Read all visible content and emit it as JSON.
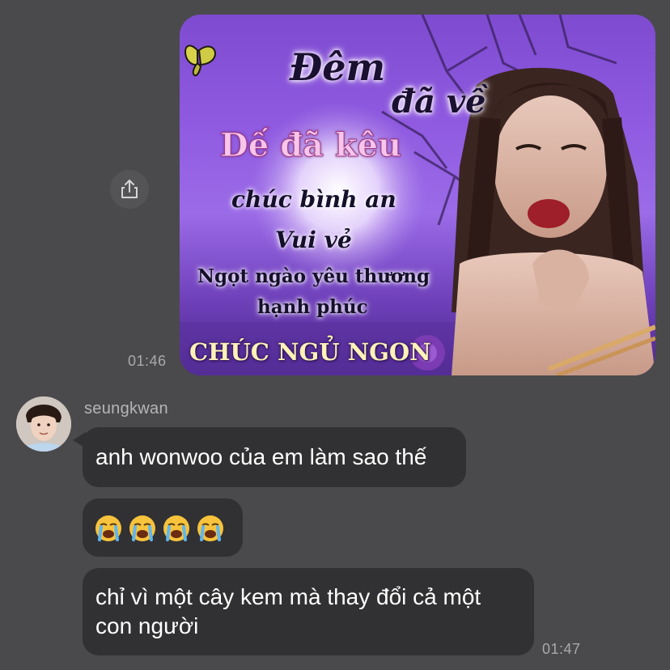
{
  "messages": {
    "outgoing_image": {
      "text_lines": {
        "line1": "Đêm",
        "line2": "đã về",
        "line3": "Dế đã kêu",
        "line4": "chúc bình an",
        "line5": "Vui vẻ",
        "line6": "Ngọt ngào yêu thương",
        "line7": "hạnh phúc",
        "line8": "CHÚC NGỦ NGON"
      },
      "time": "01:46",
      "share_icon": "share-icon"
    },
    "incoming": {
      "sender": "seungkwan",
      "bubble1": "anh wonwoo của em làm sao thế",
      "bubble2_emojis": [
        "crying-face",
        "crying-face",
        "crying-face",
        "crying-face"
      ],
      "bubble3": "chỉ vì một cây kem mà thay đổi cả một con người",
      "time": "01:47"
    }
  },
  "colors": {
    "background": "#4a4a4c",
    "bubble": "#313133",
    "timestamp": "#a9a9ad",
    "image_purple": "#8f5ae0"
  }
}
